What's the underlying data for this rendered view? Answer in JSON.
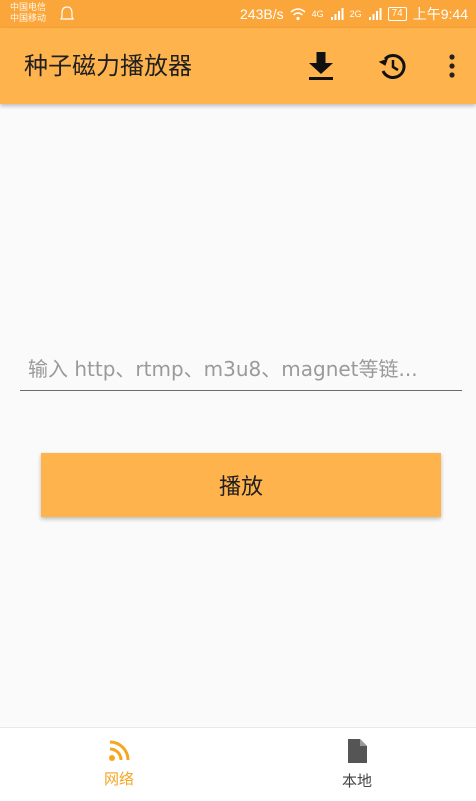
{
  "statusbar": {
    "carrier1": "中国电信",
    "carrier2": "中国移动",
    "speed": "243B/s",
    "network_a": "4G",
    "network_b": "2G",
    "battery": "74",
    "time": "上午9:44"
  },
  "appbar": {
    "title": "种子磁力播放器"
  },
  "main": {
    "url_placeholder": "输入 http、rtmp、m3u8、magnet等链...",
    "play_label": "播放"
  },
  "bottomnav": {
    "items": [
      {
        "label": "网络",
        "icon": "rss-icon",
        "active": true
      },
      {
        "label": "本地",
        "icon": "file-icon",
        "active": false
      }
    ]
  },
  "colors": {
    "accent": "#ffb34d",
    "statusbar": "#fba63a",
    "active_tab": "#f5a623",
    "inactive_tab": "#444444"
  }
}
